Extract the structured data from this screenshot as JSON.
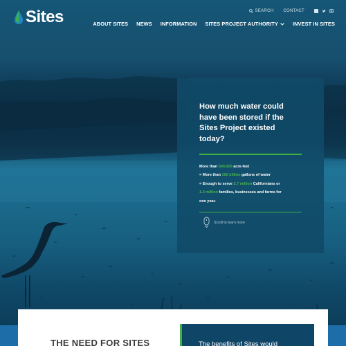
{
  "header": {
    "logo_text": "Sites",
    "utility": {
      "search": "SEARCH",
      "contact": "CONTACT",
      "social_icons": [
        "facebook-icon",
        "twitter-icon",
        "instagram-icon"
      ]
    },
    "nav": [
      {
        "label": "ABOUT SITES",
        "dropdown": false
      },
      {
        "label": "NEWS",
        "dropdown": false
      },
      {
        "label": "INFORMATION",
        "dropdown": false
      },
      {
        "label": "SITES PROJECT AUTHORITY",
        "dropdown": true
      },
      {
        "label": "INVEST IN SITES",
        "dropdown": false
      }
    ]
  },
  "card": {
    "heading": "How much water could have been stored if the Sites Project existed today?",
    "stats": {
      "l1_pre": "More than ",
      "l1_val": "500,000",
      "l1_post": " acre-feet",
      "l2_pre": "= More than ",
      "l2_val": "162 billion",
      "l2_post": " gallons of water",
      "l3_pre": "= Enough to serve ",
      "l3_val": "3.7 million",
      "l3_post": " Californians or",
      "l4_val": "1.2 million",
      "l4_post": " families, businesses and farms for",
      "l5": "one year."
    },
    "scroll_text": "Scroll to learn more"
  },
  "sections": {
    "need_title": "THE NEED FOR SITES",
    "benefits_text": "The benefits of Sites would"
  },
  "colors": {
    "accent_green": "#3fb142",
    "brand_blue": "#0b4d6c"
  }
}
